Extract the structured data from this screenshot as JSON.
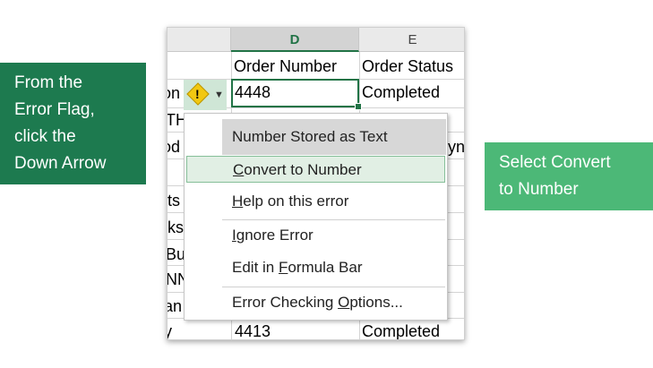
{
  "callouts": {
    "left": [
      "From the",
      "Error Flag,",
      "click the",
      "Down Arrow"
    ],
    "right": [
      "Select Convert",
      "to Number"
    ]
  },
  "sheet": {
    "columns": [
      "D",
      "E"
    ],
    "headers": {
      "d": "Order Number",
      "e": "Order Status"
    },
    "rows": [
      {
        "c": "on",
        "d": "4448",
        "e": "Completed"
      },
      {
        "c": "TH",
        "d": "",
        "e": ""
      },
      {
        "c": "od",
        "d": "",
        "e": "yn"
      },
      {
        "c": "rts",
        "d": "",
        "e": ""
      },
      {
        "c": "lks",
        "d": "",
        "e": ""
      },
      {
        "c": "Bu",
        "d": "",
        "e": ""
      },
      {
        "c": "NN",
        "d": "",
        "e": ""
      },
      {
        "c": "an",
        "d": "",
        "e": ""
      },
      {
        "c": "y",
        "d": "4413",
        "e": "Completed"
      }
    ]
  },
  "error_flag": {
    "icon": "warning-diamond-icon",
    "arrow_icon": "dropdown-arrow-icon",
    "color": "#f2c811"
  },
  "menu": {
    "header": "Number Stored as Text",
    "items": [
      {
        "pre": "",
        "key": "C",
        "post": "onvert to Number"
      },
      {
        "pre": "",
        "key": "H",
        "post": "elp on this error"
      },
      {
        "pre": "",
        "key": "I",
        "post": "gnore Error"
      },
      {
        "pre": "Edit in ",
        "key": "F",
        "post": "ormula Bar"
      },
      {
        "pre": "Error Checking ",
        "key": "O",
        "post": "ptions..."
      }
    ]
  },
  "colors": {
    "accent": "#217346",
    "callout_dark": "#1d7a4f",
    "callout_light": "#4cb877"
  }
}
